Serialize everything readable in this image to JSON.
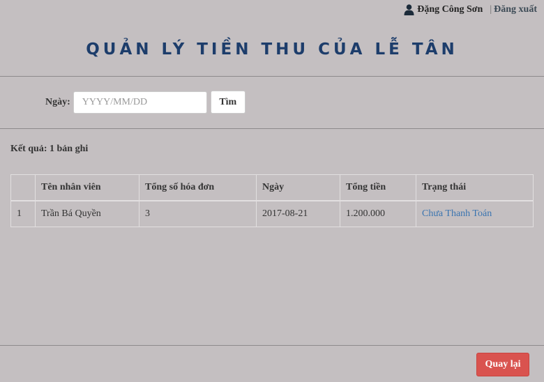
{
  "header": {
    "user_name": "Đặng Công Sơn",
    "separator": "|",
    "logout_label": "Đăng xuất",
    "user_icon": "user-icon"
  },
  "page_title": "QUẢN LÝ TIỀN THU CỦA LỄ TÂN",
  "search": {
    "date_label": "Ngày:",
    "date_placeholder": "YYYY/MM/DD",
    "button_label": "Tìm"
  },
  "result_text": "Kết quả: 1 bản ghi",
  "table": {
    "columns": [
      "",
      "Tên nhân viên",
      "Tổng số hóa đơn",
      "Ngày",
      "Tổng tiền",
      "Trạng thái"
    ],
    "rows": [
      {
        "index": "1",
        "employee": "Trần Bá Quyền",
        "invoice_count": "3",
        "date": "2017-08-21",
        "total": "1.200.000",
        "status": "Chưa Thanh Toán"
      }
    ]
  },
  "back_button_label": "Quay lại",
  "colors": {
    "background": "#c4bfc1",
    "title": "#1d3d6b",
    "danger": "#d9534f",
    "link": "#3a74b0"
  }
}
